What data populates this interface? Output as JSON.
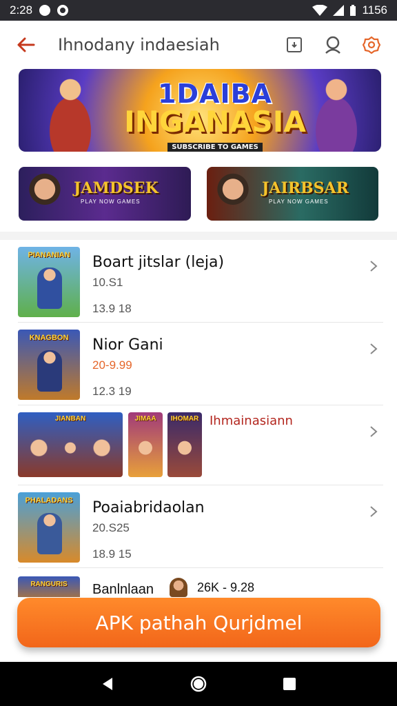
{
  "status_bar": {
    "time": "2:28",
    "battery": "1156"
  },
  "app_bar": {
    "title": "Ihnodany indaesiah"
  },
  "banner": {
    "line1": "1DAIBA",
    "line2": "INGANASIA",
    "line3": "SUBSCRIBE TO GAMES"
  },
  "cards": [
    {
      "title": "JAMDSEK",
      "subtitle": "PLAY NOW GAMES"
    },
    {
      "title": "JAIRBSAR",
      "subtitle": "PLAY NOW GAMES"
    }
  ],
  "list": [
    {
      "thumb_label": "PIANANIAN",
      "title": "Boart jitslar (leja)",
      "subtitle": "10.S1",
      "meta": "13.9 18"
    },
    {
      "thumb_label": "KNAGBON",
      "title": "Nior Gani",
      "subtitle": "20-9.99",
      "meta": "12.3 19",
      "subtitle_color": "#e5662a"
    },
    {
      "thumb_labels": [
        "JIANBAN",
        "JIMAA",
        "IHOMAR"
      ],
      "title": "Ihmainasiann"
    },
    {
      "thumb_label": "PHALADANS",
      "title": "Poaiabridaolan",
      "subtitle": "20.S25",
      "meta": "18.9 15"
    }
  ],
  "partial_row": {
    "thumb_label": "RANGURIS",
    "title": "Banlnlaan",
    "meta": "26K - 9.28"
  },
  "cta": {
    "label": "APK pathah Qurjdmel"
  },
  "colors": {
    "accent": "#f2661a",
    "back_arrow": "#c5391d"
  }
}
